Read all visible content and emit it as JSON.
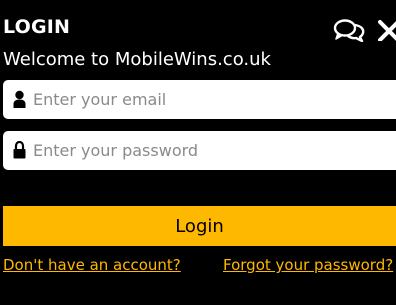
{
  "header": {
    "title": "LOGIN"
  },
  "welcome": "Welcome to MobileWins.co.uk",
  "form": {
    "email_placeholder": "Enter your email",
    "password_placeholder": "Enter your password",
    "login_label": "Login"
  },
  "links": {
    "signup": "Don't have an account?",
    "forgot": "Forgot your password?"
  },
  "icons": {
    "chat": "chat-bubbles-icon",
    "close": "close-icon",
    "email": "user-icon",
    "password": "lock-icon"
  },
  "colors": {
    "background": "#000000",
    "accent": "#ffb800",
    "text": "#ffffff",
    "field_bg": "#ffffff",
    "placeholder": "#8a8a8a"
  }
}
